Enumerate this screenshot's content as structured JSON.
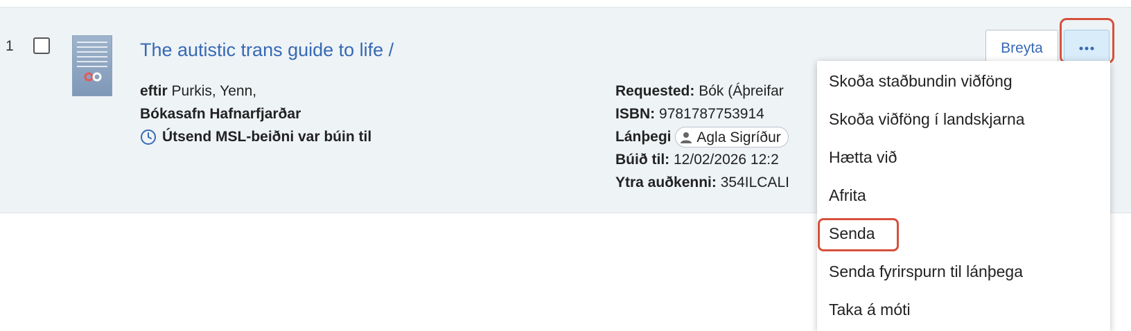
{
  "record": {
    "index": "1",
    "title": "The autistic trans guide to life /",
    "author_label": "eftir",
    "author": "Purkis, Yenn,",
    "library": "Bókasafn Hafnarfjarðar",
    "status": "Útsend MSL-beiðni var búin til",
    "cover": {
      "title_lines": [
        "The",
        "Autistic",
        "Trans",
        "Guide",
        "to Life"
      ]
    }
  },
  "details": {
    "requested_label": "Requested:",
    "requested_value": "Bók (Áþreifar",
    "isbn_label": "ISBN:",
    "isbn_value": "9781787753914",
    "patron_label": "Lánþegi",
    "patron_name": "Agla Sigríður",
    "created_label": "Búið til:",
    "created_value": "12/02/2026 12:2",
    "external_id_label": "Ytra auðkenni:",
    "external_id_value": "354ILCALI"
  },
  "actions": {
    "edit_label": "Breyta",
    "more_label": "•••"
  },
  "dropdown": {
    "items": [
      "Skoða staðbundin viðföng",
      "Skoða viðföng í landskjarna",
      "Hætta við",
      "Afrita",
      "Senda",
      "Senda fyrirspurn til lánþega",
      "Taka á móti"
    ]
  },
  "colors": {
    "link": "#3769b4",
    "row_background": "#eef3f6",
    "highlight": "#d6503a",
    "more_button_bg": "#d9ecf9"
  }
}
